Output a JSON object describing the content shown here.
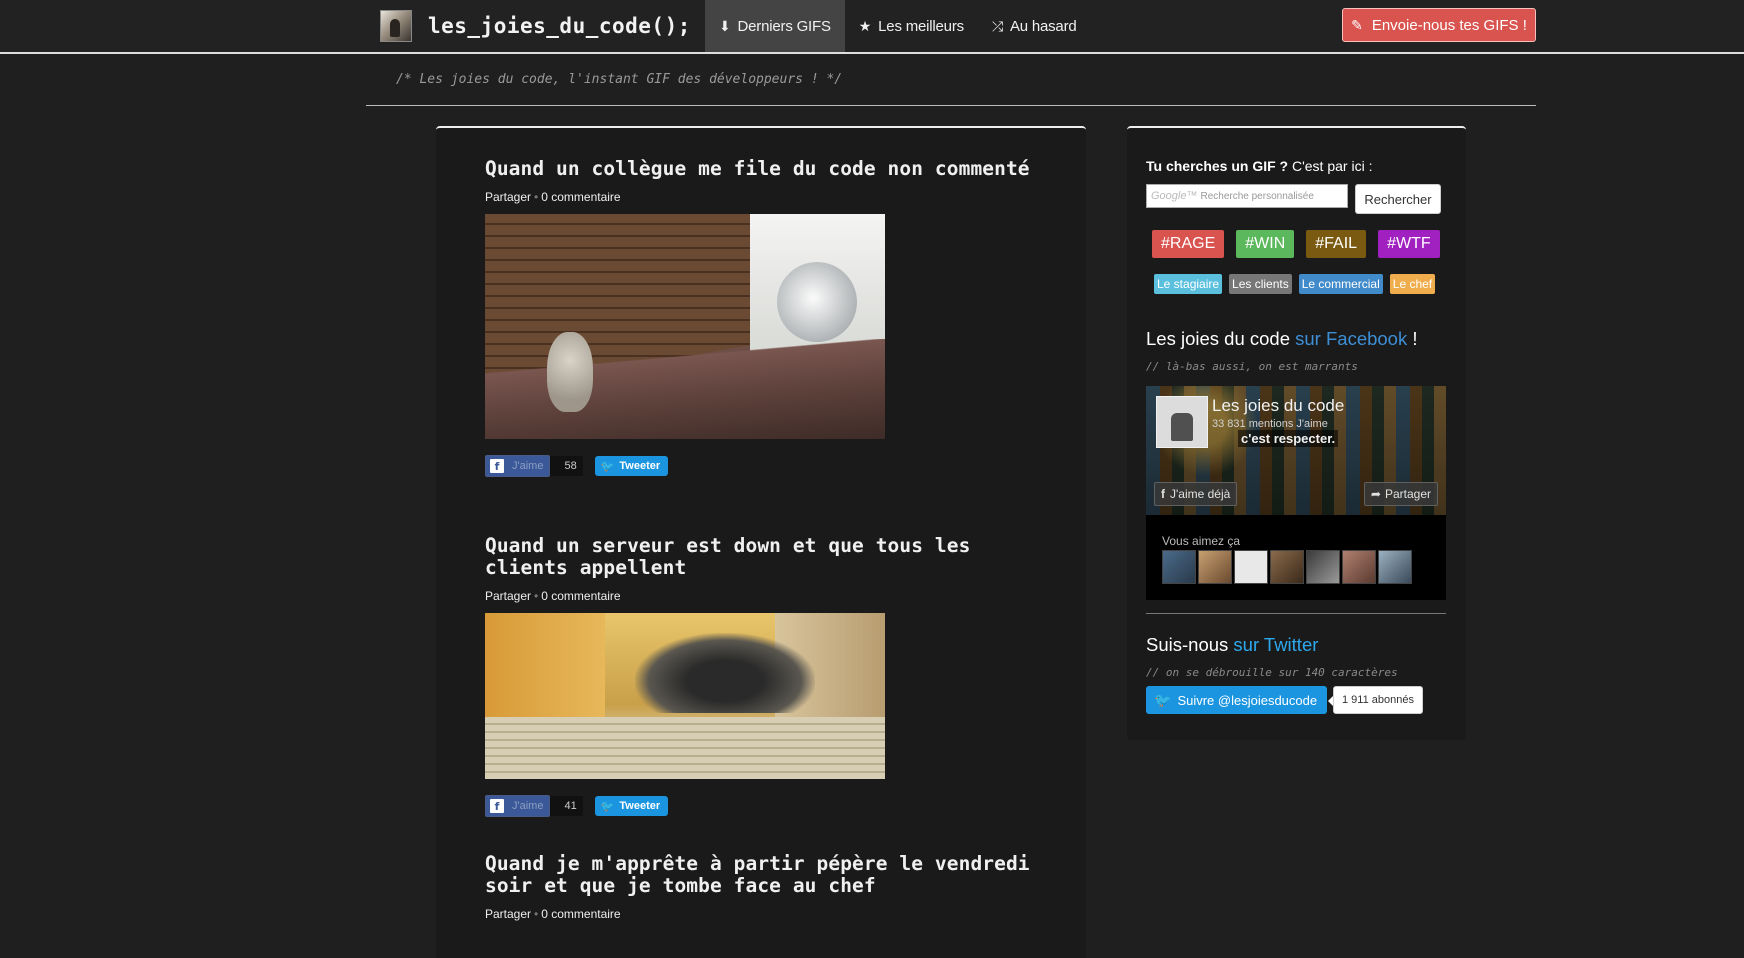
{
  "nav": {
    "brand": "les_joies_du_code();",
    "items": [
      {
        "label": "Derniers GIFS",
        "icon": "download-circle-icon",
        "glyph": "⬇"
      },
      {
        "label": "Les meilleurs",
        "icon": "star-icon",
        "glyph": "★"
      },
      {
        "label": "Au hasard",
        "icon": "shuffle-icon",
        "glyph": "⤮"
      }
    ],
    "active_index": 0,
    "submit_label": "Envoie-nous tes GIFS !",
    "submit_icon": "pencil-icon"
  },
  "tagline": "/* Les joies du code, l'instant GIF des développeurs ! */",
  "posts": [
    {
      "title": "Quand un collègue me file du code non commenté",
      "share": "Partager",
      "comments": "0 commentaire",
      "fb_like": "J'aime",
      "fb_count": "58",
      "tweet": "Tweeter"
    },
    {
      "title": "Quand un serveur est down et que tous les clients appellent",
      "share": "Partager",
      "comments": "0 commentaire",
      "fb_like": "J'aime",
      "fb_count": "41",
      "tweet": "Tweeter"
    },
    {
      "title": "Quand je m'apprête à partir pépère le vendredi soir et que je tombe face au chef",
      "share": "Partager",
      "comments": "0 commentaire"
    }
  ],
  "sidebar": {
    "search": {
      "title_bold": "Tu cherches un GIF ?",
      "title_rest": " C'est par ici :",
      "google_label": "Google™",
      "placeholder": "Recherche personnalisée",
      "button": "Rechercher"
    },
    "tags": [
      {
        "label": "#RAGE",
        "color": "#d9534f"
      },
      {
        "label": "#WIN",
        "color": "#5cb85c"
      },
      {
        "label": "#FAIL",
        "color": "#7a5a10"
      },
      {
        "label": "#WTF",
        "color": "#a020c0"
      }
    ],
    "roles": [
      {
        "label": "Le stagiaire",
        "color": "#5bc0de"
      },
      {
        "label": "Les clients",
        "color": "#777777"
      },
      {
        "label": "Le commercial",
        "color": "#428bca"
      },
      {
        "label": "Le chef",
        "color": "#f0ad4e"
      }
    ],
    "facebook": {
      "heading_pre": "Les joies du code ",
      "heading_link": "sur Facebook",
      "heading_post": " !",
      "sub": "// là-bas aussi, on est marrants",
      "page_name": "Les joies du code",
      "page_likes": "33 831 mentions J'aime",
      "cover_text": "c'est respecter.",
      "liked_label": "J'aime déjà",
      "share_label": "Partager",
      "likers_label": "Vous aimez ça"
    },
    "twitter": {
      "heading_pre": "Suis-nous ",
      "heading_link": "sur Twitter",
      "sub": "// on se débrouille sur 140 caractères",
      "follow_label": "Suivre @lesjoiesducode",
      "followers": "1 911 abonnés"
    }
  }
}
